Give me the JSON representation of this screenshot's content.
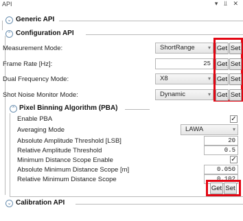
{
  "window": {
    "title": "API",
    "icons": [
      "pin-icon",
      "dock-icon",
      "close-icon"
    ],
    "controls_text": "▾ ⫫ ✕"
  },
  "generic_api": {
    "title": "Generic API",
    "expanded": false
  },
  "configuration_api": {
    "title": "Configuration API",
    "expanded": true,
    "rows": [
      {
        "label": "Measurement Mode:",
        "type": "combo",
        "value": "ShortRange",
        "get": "Get",
        "set": "Set"
      },
      {
        "label": "Frame Rate [Hz]:",
        "type": "input",
        "value": "25",
        "get": "Get",
        "set": "Set"
      },
      {
        "label": "Dual Frequency Mode:",
        "type": "combo",
        "value": "X8",
        "get": "Get",
        "set": "Set"
      },
      {
        "label": "Shot Noise Monitor Mode:",
        "type": "combo",
        "value": "Dynamic",
        "get": "Get",
        "set": "Set"
      }
    ]
  },
  "pba": {
    "title": "Pixel Binning Algorithm (PBA)",
    "expanded": true,
    "rows": [
      {
        "label": "Enable PBA",
        "type": "checkbox",
        "checked": true
      },
      {
        "label": "Averaging Mode",
        "type": "combo",
        "value": "LAWA"
      },
      {
        "label": "Absolute Amplitude Threshold [LSB]",
        "type": "input",
        "value": "20"
      },
      {
        "label": "Relative Amplitude Threshold",
        "type": "input",
        "value": "0.5"
      },
      {
        "label": "Minimum Distance Scope Enable",
        "type": "checkbox",
        "checked": true
      },
      {
        "label": "Absolute Minimum Distance Scope [m]",
        "type": "input",
        "value": "0.050"
      },
      {
        "label": "Relative Minimum Distance Scope",
        "type": "input",
        "value": "0.102"
      }
    ],
    "get": "Get",
    "set": "Set"
  },
  "calibration_api": {
    "title": "Calibration API",
    "expanded": false
  },
  "colors": {
    "highlight": "#e30613",
    "group_line": "#b9b9b9",
    "expander": "#6a8fb0"
  },
  "icons": {
    "collapsed": "chevron-down-icon",
    "expanded": "chevron-up-icon",
    "check": "checkmark-icon"
  },
  "glyphs": {
    "chevron_down": "⌄",
    "chevron_up": "⌃",
    "dropdown_arrow": "▾",
    "check": "✓"
  }
}
